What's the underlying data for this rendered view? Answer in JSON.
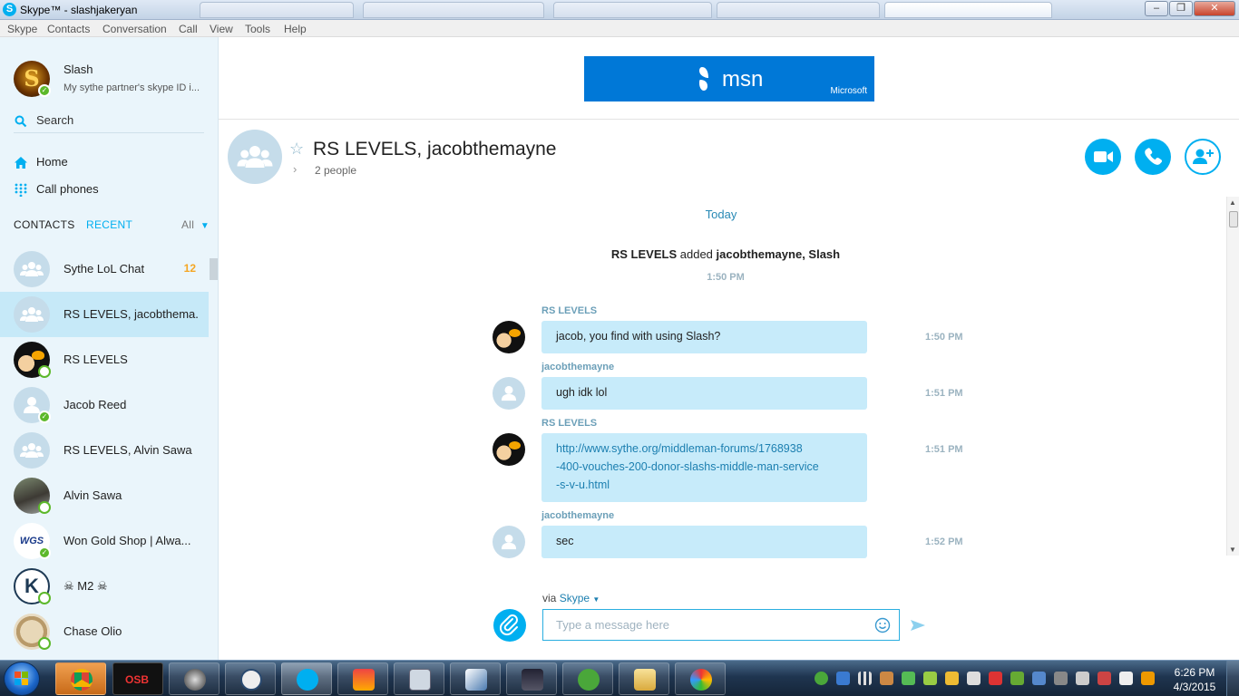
{
  "window": {
    "title": "Skype™ - slashjakeryan",
    "app_icon": "S",
    "min": "–",
    "max": "❐",
    "close": "✕"
  },
  "menu": [
    "Skype",
    "Contacts",
    "Conversation",
    "Call",
    "View",
    "Tools",
    "Help"
  ],
  "profile": {
    "name": "Slash",
    "mood": "My sythe partner's skype ID i...",
    "avatar_letter": "S"
  },
  "search": {
    "label": "Search"
  },
  "nav": {
    "home": "Home",
    "call_phones": "Call phones"
  },
  "tabs": {
    "contacts": "CONTACTS",
    "recent": "RECENT",
    "filter": "All"
  },
  "recent": [
    {
      "name": "Sythe LoL Chat",
      "badge": "12",
      "type": "group"
    },
    {
      "name": "RS LEVELS, jacobthema...",
      "type": "group",
      "selected": true
    },
    {
      "name": "RS LEVELS",
      "type": "penguin"
    },
    {
      "name": "Jacob Reed",
      "type": "person"
    },
    {
      "name": "RS LEVELS, Alvin Sawa",
      "type": "group"
    },
    {
      "name": "Alvin Sawa",
      "type": "photo"
    },
    {
      "name": "Won Gold Shop | Alwa...",
      "type": "logo",
      "logo_text": "WGS"
    },
    {
      "name": "☠ M2 ☠",
      "type": "k",
      "logo_text": "K"
    },
    {
      "name": "Chase Olio",
      "type": "coin"
    }
  ],
  "ad": {
    "logo": "msn",
    "brand": "Microsoft"
  },
  "conversation": {
    "title": "RS LEVELS, jacobthemayne",
    "participants": "2 people",
    "day": "Today",
    "system": {
      "actor": "RS LEVELS",
      "verb": "added",
      "targets": "jacobthemayne, Slash",
      "time": "1:50 PM"
    },
    "messages": [
      {
        "sender": "RS LEVELS",
        "text": "jacob, you find with using Slash?",
        "time": "1:50 PM",
        "avatar": "penguin"
      },
      {
        "sender": "jacobthemayne",
        "text": "ugh idk lol",
        "time": "1:51 PM",
        "avatar": "person"
      },
      {
        "sender": "RS LEVELS",
        "link_lines": [
          "http://www.sythe.org/middleman-forums/1768938",
          "-400-vouches-200-donor-slashs-middle-man-service",
          "-s-v-u.html"
        ],
        "time": "1:51 PM",
        "avatar": "penguin"
      },
      {
        "sender": "jacobthemayne",
        "text": "sec",
        "time": "1:52 PM",
        "avatar": "person"
      }
    ]
  },
  "composer": {
    "via": "via",
    "via_service": "Skype",
    "placeholder": "Type a message here"
  },
  "taskbar": {
    "time": "6:26 PM",
    "date": "4/3/2015",
    "osb_label": "OSB"
  },
  "colors": {
    "accent": "#00aff0",
    "bubble": "#c7ebfa",
    "sidebar": "#eaf5fb",
    "presence": "#5cb82a",
    "badge": "#f5a623",
    "ad": "#0078d7"
  }
}
